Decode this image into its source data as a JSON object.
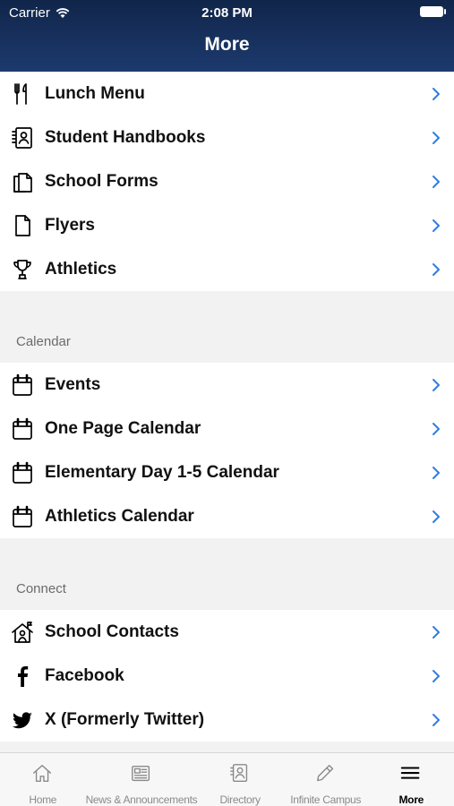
{
  "status": {
    "carrier": "Carrier",
    "time": "2:08 PM"
  },
  "nav": {
    "title": "More"
  },
  "groups": [
    {
      "items": [
        {
          "label": "Lunch Menu",
          "icon": "utensils-icon"
        },
        {
          "label": "Student Handbooks",
          "icon": "handbook-icon"
        },
        {
          "label": "School Forms",
          "icon": "forms-icon"
        },
        {
          "label": "Flyers",
          "icon": "document-icon"
        },
        {
          "label": "Athletics",
          "icon": "trophy-icon"
        }
      ]
    },
    {
      "header": "Calendar",
      "items": [
        {
          "label": "Events",
          "icon": "calendar-icon"
        },
        {
          "label": "One Page Calendar",
          "icon": "calendar-icon"
        },
        {
          "label": "Elementary Day 1-5 Calendar",
          "icon": "calendar-icon"
        },
        {
          "label": "Athletics Calendar",
          "icon": "calendar-icon"
        }
      ]
    },
    {
      "header": "Connect",
      "items": [
        {
          "label": "School Contacts",
          "icon": "school-contacts-icon"
        },
        {
          "label": "Facebook",
          "icon": "facebook-icon"
        },
        {
          "label": "X (Formerly Twitter)",
          "icon": "twitter-icon"
        }
      ]
    }
  ],
  "tabs": [
    {
      "label": "Home",
      "icon": "home-icon",
      "active": false
    },
    {
      "label": "News & Announcements",
      "icon": "newspaper-icon",
      "active": false
    },
    {
      "label": "Directory",
      "icon": "directory-icon",
      "active": false
    },
    {
      "label": "Infinite Campus",
      "icon": "pencil-icon",
      "active": false
    },
    {
      "label": "More",
      "icon": "menu-icon",
      "active": true
    }
  ],
  "colors": {
    "header": "#1d3a6e",
    "chevron": "#2f7de1",
    "background": "#f2f2f3"
  }
}
